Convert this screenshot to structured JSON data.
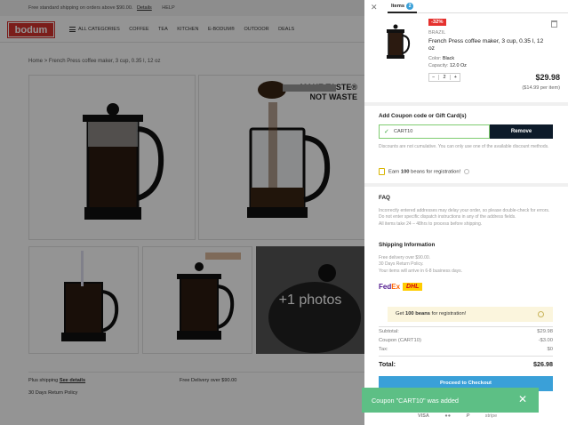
{
  "site": {
    "topbar": {
      "shipping_text": "Free standard shipping on orders above $90.00.",
      "details_link": "Details",
      "help_label": "HELP"
    },
    "logo_text": "bodum",
    "nav": [
      "ALL CATEGORIES",
      "COFFEE",
      "TEA",
      "KITCHEN",
      "E-BODUM®",
      "OUTDOOR",
      "DEALS"
    ],
    "breadcrumb": {
      "home": "Home",
      "sep": ">",
      "current": "French Press coffee maker, 3 cup, 0.35 l, 12 oz"
    },
    "hero_tagline": [
      "MAKE TASTE®",
      "NOT WASTE"
    ],
    "more_photos": "+1 photos",
    "plus_shipping": "Plus shipping",
    "see_details": "See details",
    "free_delivery": "Free Delivery over $90.00",
    "returns": "30 Days Return Policy"
  },
  "cart": {
    "tab_label": "Items",
    "tab_count": "2",
    "item": {
      "discount_badge": "-32%",
      "brand": "BRAZIL",
      "name": "French Press coffee maker, 3 cup, 0.35 l, 12 oz",
      "color_label": "Color:",
      "color_value": "Black",
      "capacity_label": "Capacity:",
      "capacity_value": "12.0 Oz",
      "qty_minus": "−",
      "quantity": "2",
      "qty_plus": "+",
      "price": "$29.98",
      "per_item": "($14.99 per item)"
    },
    "coupon": {
      "title": "Add Coupon code or Gift Card(s)",
      "code": "CART10",
      "remove_label": "Remove",
      "note": "Discounts are not cumulative. You can only use one of the available discount methods."
    },
    "beans_line": {
      "pre": "Earn ",
      "amount": "100",
      "post": " beans for registration!"
    },
    "faq": {
      "title": "FAQ",
      "lines": [
        "Incorrectly entered addresses may delay your order, so please double-check for errors.",
        "Do not enter specific dispatch instructions in any of the address fields.",
        "All items take 24 – 48hrs to process before shipping."
      ]
    },
    "shipping_info": {
      "title": "Shipping Information",
      "lines": [
        "Free delivery over $90.00.",
        "30 Days Return Policy.",
        "Your items will arrive in 6-8 business days."
      ],
      "carrier1_a": "Fed",
      "carrier1_b": "Ex",
      "carrier2": "DHL"
    },
    "beans_bar": {
      "pre": "Get ",
      "amount": "100 beans",
      "post": " for registration!"
    },
    "summary": {
      "subtotal_label": "Subtotal:",
      "subtotal": "$29.98",
      "coupon_label": "Coupon (CART10)",
      "coupon": "-$3.00",
      "tax_label": "Tax:",
      "tax": "$0",
      "total_label": "Total:",
      "total": "$26.98"
    },
    "checkout_label": "Proceed to Checkout",
    "payments": [
      "VISA",
      "●●",
      "P",
      "stripe"
    ]
  },
  "toast": {
    "message": "Coupon \"CART10\" was added",
    "close": "✕"
  },
  "colors": {
    "accent": "#3aa0d8",
    "brand": "#d5322e",
    "toast": "#5dbf85",
    "button_dark": "#0d1b2a"
  }
}
